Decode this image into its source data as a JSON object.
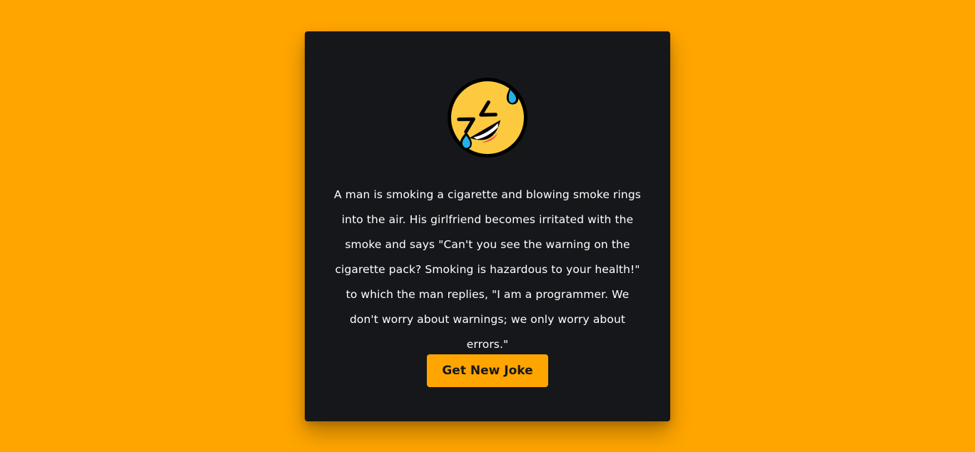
{
  "joke": {
    "text": "A man is smoking a cigarette and blowing smoke rings into the air. His girlfriend becomes irritated with the smoke and says \"Can't you see the warning on the cigarette pack? Smoking is hazardous to your health!\" to which the man replies, \"I am a programmer. We don't worry about warnings; we only worry about errors.\""
  },
  "button": {
    "label": "Get New Joke"
  },
  "icon": {
    "name": "rolling-on-floor-laughing-emoji-icon"
  },
  "colors": {
    "background": "#ffa500",
    "card": "#16171b",
    "button": "#ffa500",
    "button_text": "#16171b",
    "emoji_face": "#fcc93f",
    "emoji_tears": "#22b2e8"
  }
}
